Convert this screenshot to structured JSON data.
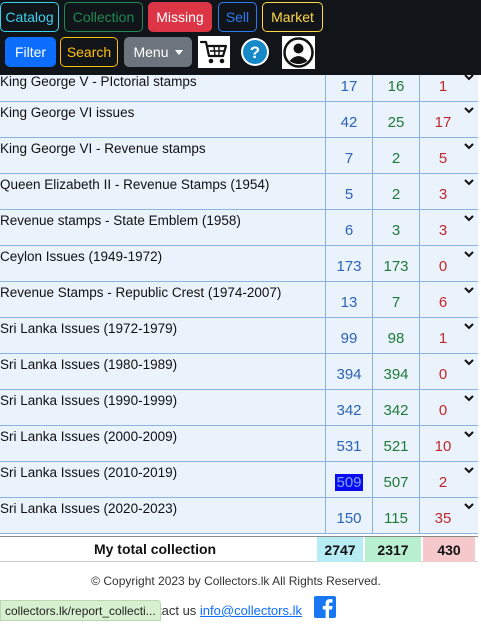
{
  "nav": {
    "catalog": "Catalog",
    "collection": "Collection",
    "missing": "Missing",
    "sell": "Sell",
    "market": "Market",
    "filter": "Filter",
    "search": "Search",
    "menu": "Menu"
  },
  "icons": {
    "cart": "shopping-cart-icon",
    "help": "help-icon",
    "user": "user-account-icon",
    "expand": "chevron-down-icon",
    "facebook": "facebook-icon"
  },
  "rows": [
    {
      "name": "King George V - PIctorial stamps",
      "total": "17",
      "have": "16",
      "missing": "1"
    },
    {
      "name": "King George VI issues",
      "total": "42",
      "have": "25",
      "missing": "17"
    },
    {
      "name": "King George VI - Revenue stamps",
      "total": "7",
      "have": "2",
      "missing": "5"
    },
    {
      "name": "Queen Elizabeth II - Revenue Stamps (1954)",
      "total": "5",
      "have": "2",
      "missing": "3"
    },
    {
      "name": "Revenue stamps - State Emblem (1958)",
      "total": "6",
      "have": "3",
      "missing": "3"
    },
    {
      "name": "Ceylon Issues (1949-1972)",
      "total": "173",
      "have": "173",
      "missing": "0"
    },
    {
      "name": "Revenue Stamps - Republic Crest (1974-2007)",
      "total": "13",
      "have": "7",
      "missing": "6"
    },
    {
      "name": "Sri Lanka Issues (1972-1979)",
      "total": "99",
      "have": "98",
      "missing": "1"
    },
    {
      "name": "Sri Lanka Issues (1980-1989)",
      "total": "394",
      "have": "394",
      "missing": "0"
    },
    {
      "name": "Sri Lanka Issues (1990-1999)",
      "total": "342",
      "have": "342",
      "missing": "0"
    },
    {
      "name": "Sri Lanka Issues (2000-2009)",
      "total": "531",
      "have": "521",
      "missing": "10"
    },
    {
      "name": "Sri Lanka Issues (2010-2019)",
      "total": "509",
      "have": "507",
      "missing": "2"
    },
    {
      "name": "Sri Lanka Issues (2020-2023)",
      "total": "150",
      "have": "115",
      "missing": "35"
    }
  ],
  "totals": {
    "label": "My total collection",
    "total": "2747",
    "have": "2317",
    "missing": "430"
  },
  "footer": {
    "copyright": "© Copyright 2023 by Collectors.lk All Rights Reserved.",
    "contact_prefix": "tact us ",
    "email": "info@collectors.lk",
    "status_url": "collectors.lk/report_collecti..."
  },
  "colors": {
    "total": "#2b63b8",
    "have": "#1f7a3a",
    "missing": "#c0272d",
    "row_bg": "#eaf2fb",
    "nav_bg": "#111418"
  }
}
